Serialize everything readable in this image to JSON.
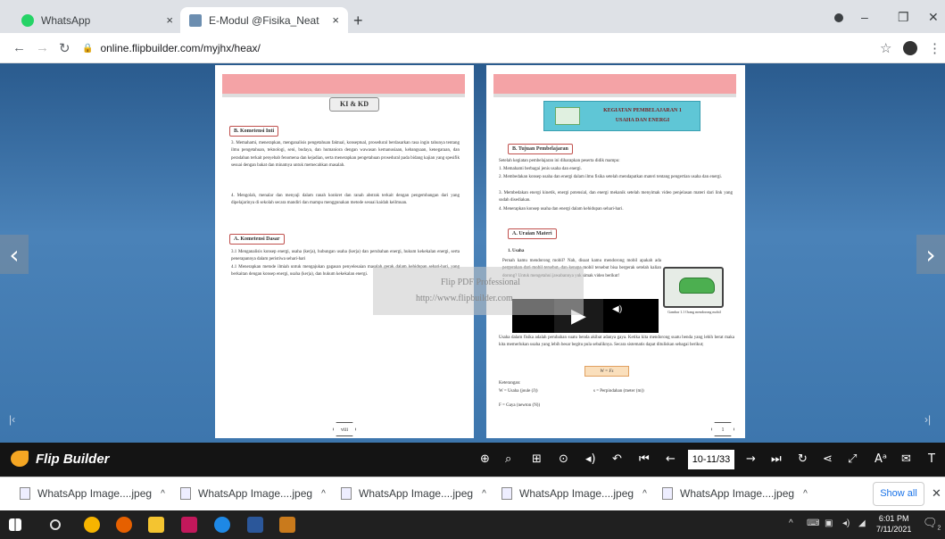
{
  "tabs": [
    {
      "title": "WhatsApp",
      "close": "×"
    },
    {
      "title": "E-Modul @Fisika_Neat",
      "close": "×"
    }
  ],
  "new_tab": "+",
  "window_controls": {
    "minimize": "–",
    "maximize": "❐",
    "close": "✕"
  },
  "address": {
    "url": "online.flipbuilder.com/myjhx/heax/"
  },
  "book": {
    "left": {
      "heading": "KI & KD",
      "sec1": "B. Kometensi Inti",
      "p3": "3. Memahami, menerapkan, menganalisis pengetahuan faktual, konseptual, prosedural berdasarkan rasa ingin tahunya tentang ilmu pengetahuan, teknologi, seni, budaya, dan humaniora dengan wawasan kemanusiaan, kebangsaan, kenegaraan, dan peradaban terkait penyebab fenomena dan kejadian, serta menerapkan pengetahuan prosedural pada bidang kajian yang spesifik sesuai dengan bakat dan minatnya untuk memecahkan masalah.",
      "p4": "4. Mengolah, menalar dan menyaji dalam ranah konkret dan ranah abstrak terkait dengan pengembangan dari yang dipelajarinya di sekolah secara mandiri dan mampu menggunakan metode sesuai kaidah keilmuan.",
      "sec2": "A. Kometensi Dasar",
      "kd1": "3.1 Menganalisis konsep energi, usaha (kerja), hubungan usaha (kerja) dan perubahan energi, hukum kekekalan energi, serta penerapannya dalam peristiwa sehari-hari",
      "kd2": "4.1 Menerapkan metode ilmiah untuk mengajukan gagasan penyelesaian masalah gerak dalam kehidupan sehari-hari, yang berkaitan dengan konsep energi, usaha (kerja), dan hukum kekekalan energi.",
      "page_no": "viii"
    },
    "right": {
      "title1": "KEGIATAN PEMBELAJARAN 1",
      "title2": "USAHA DAN ENERGI",
      "sec1": "B. Tujuan Pembelajaran",
      "intro": "Setelah kegiatan pembelajaran ini diharapkan peserta didik mampu:",
      "goals": [
        "1. Memahami berbagai jenis usaha dan energi.",
        "2. Membedakan konsep usaha dan energi dalam ilmu fisika setelah mendapatkan materi tentang pengertian usaha dan energi.",
        "3. Membedakan energi kinetik, energi potensial, dan energi mekanik setelah menyimak video penjelasan materi dari link yang sudah disediakan.",
        "4. Menerapkan konsep usaha dan energi dalam kehidupan sehari-hari."
      ],
      "sec2": "A. Uraian Materi",
      "sub": "1. Usaha",
      "body1": "Pernah kamu mendorong mobil? Nah, disaat kamu mendorong mobil apakah ada pergerakan dari mobil tersebut, dan kenapa mobil tersebut bisa bergerak setelah kalian dorong? Untuk mengetahui jawabannya yuk simak video berikut!",
      "caption": "Gambar 1.1 Orang mendorong mobil",
      "body2": "Usaha dalam fisika adalah perubahan suatu benda akibat adanya gaya. Ketika kita mendorong suatu benda yang lebih berat maka kita memerlukan usaha yang lebih besar begitu pula sebaliknya. Secara sistematis dapat dituliskan sebagai berikut;",
      "formula": "W = Fs",
      "ket": "Keterangan:",
      "ket1": "W = Usaha (joule (J))",
      "ket2": "s = Perpindahan (meter (m))",
      "ket3": "F = Gaya (newton (N))",
      "page_no": "1"
    }
  },
  "watermark": {
    "line1": "Flip PDF Professional",
    "line2": "http://www.flipbuilder.com"
  },
  "stage": {
    "prev": "‹",
    "next": "›",
    "first": "|‹",
    "last": "›|"
  },
  "toolbar": {
    "brand": "Flip Builder",
    "page_indicator": "10-11/33"
  },
  "downloads": {
    "items": [
      "WhatsApp Image....jpeg",
      "WhatsApp Image....jpeg",
      "WhatsApp Image....jpeg",
      "WhatsApp Image....jpeg",
      "WhatsApp Image....jpeg"
    ],
    "show_all": "Show all",
    "close": "✕"
  },
  "taskbar": {
    "time": "6:01 PM",
    "date": "7/11/2021",
    "notif": "2"
  },
  "colors": {
    "band": "#f4a3a6",
    "toolbar": "#141414",
    "stage": "#3d76ad"
  }
}
